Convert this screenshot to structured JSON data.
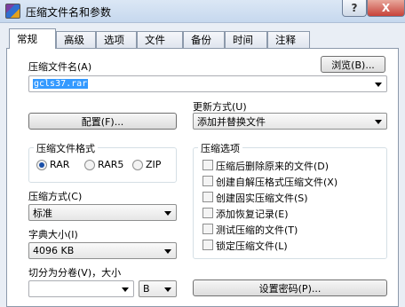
{
  "window": {
    "title": "压缩文件名和参数",
    "help_label": "?",
    "close_label": "X"
  },
  "tabs": [
    "常规",
    "高级",
    "选项",
    "文件",
    "备份",
    "时间",
    "注释"
  ],
  "archive_name": {
    "label": "压缩文件名(A)",
    "value": "gcls37.rar",
    "browse_label": "浏览(B)..."
  },
  "update_mode": {
    "label": "更新方式(U)",
    "value": "添加并替换文件"
  },
  "profiles_label": "配置(F)...",
  "format": {
    "title": "压缩文件格式",
    "options": [
      "RAR",
      "RAR5",
      "ZIP"
    ],
    "selected": "RAR"
  },
  "method": {
    "label": "压缩方式(C)",
    "value": "标准"
  },
  "dictionary": {
    "label": "字典大小(I)",
    "value": "4096 KB"
  },
  "split": {
    "label": "切分为分卷(V)，大小",
    "value": "",
    "unit": "B"
  },
  "options": {
    "title": "压缩选项",
    "items": [
      {
        "label": "压缩后删除原来的文件(D)",
        "checked": false
      },
      {
        "label": "创建自解压格式压缩文件(X)",
        "checked": false
      },
      {
        "label": "创建固实压缩文件(S)",
        "checked": false
      },
      {
        "label": "添加恢复记录(E)",
        "checked": false
      },
      {
        "label": "测试压缩的文件(T)",
        "checked": false
      },
      {
        "label": "锁定压缩文件(L)",
        "checked": false
      }
    ]
  },
  "password_label": "设置密码(P)..."
}
